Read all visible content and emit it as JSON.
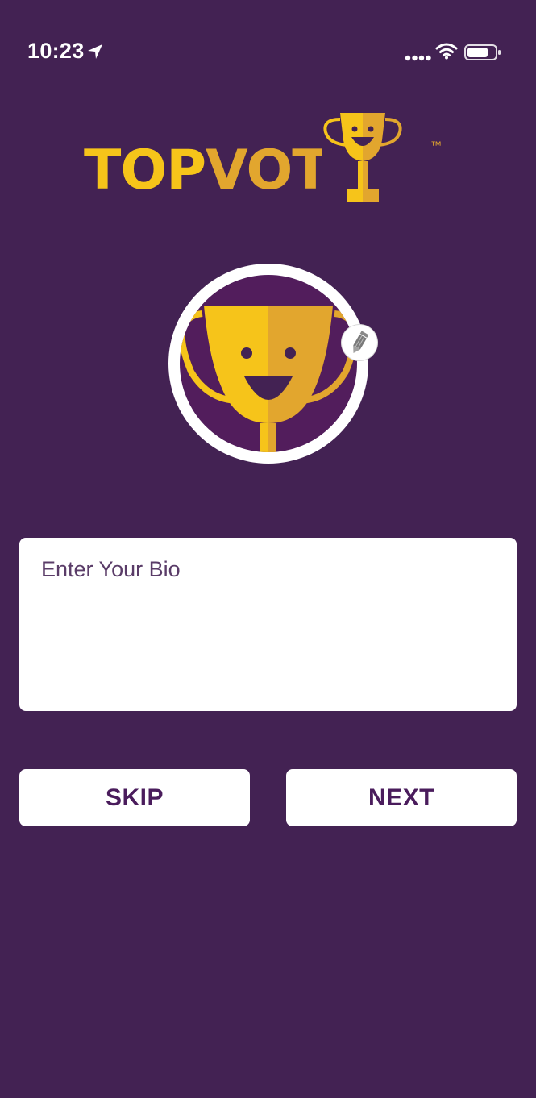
{
  "status_bar": {
    "time": "10:23",
    "icons": [
      "location-arrow-icon",
      "cellular-signal-icon",
      "wifi-icon",
      "battery-icon"
    ]
  },
  "logo": {
    "text_top": "TOP",
    "text_vote": "VOTE",
    "trademark": "™"
  },
  "avatar": {
    "edit_icon": "pencil-icon"
  },
  "bio": {
    "placeholder": "Enter Your Bio",
    "value": ""
  },
  "buttons": {
    "skip_label": "SKIP",
    "next_label": "NEXT"
  },
  "colors": {
    "background": "#432253",
    "logo_gold": "#f6c41a",
    "logo_amber": "#e2a62e",
    "button_text": "#4a1c5c",
    "surface": "#ffffff"
  }
}
